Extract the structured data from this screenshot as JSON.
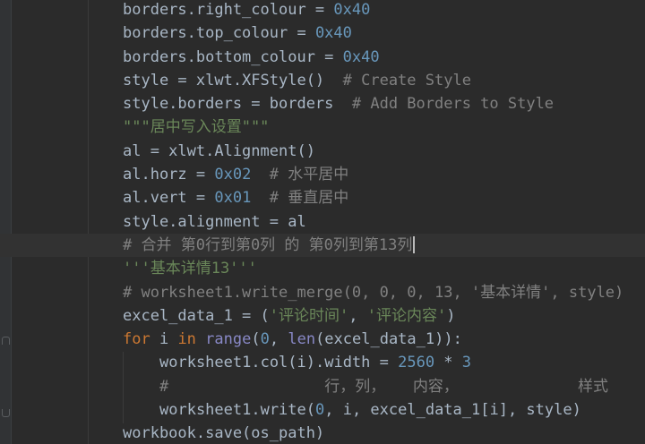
{
  "editor": {
    "lines": [
      {
        "id": "l1",
        "indent": 0,
        "tokens": [
          {
            "t": "borders.right_colour = ",
            "c": ""
          },
          {
            "t": "0x40",
            "c": "num"
          }
        ]
      },
      {
        "id": "l2",
        "indent": 0,
        "tokens": [
          {
            "t": "borders.top_colour = ",
            "c": ""
          },
          {
            "t": "0x40",
            "c": "num"
          }
        ]
      },
      {
        "id": "l3",
        "indent": 0,
        "tokens": [
          {
            "t": "borders.bottom_colour = ",
            "c": ""
          },
          {
            "t": "0x40",
            "c": "num"
          }
        ]
      },
      {
        "id": "l4",
        "indent": 0,
        "tokens": [
          {
            "t": "style = xlwt.XFStyle()  ",
            "c": ""
          },
          {
            "t": "# Create Style",
            "c": "cmt"
          }
        ]
      },
      {
        "id": "l5",
        "indent": 0,
        "tokens": [
          {
            "t": "style.borders = borders  ",
            "c": ""
          },
          {
            "t": "# Add Borders to Style",
            "c": "cmt"
          }
        ]
      },
      {
        "id": "l6",
        "indent": 0,
        "tokens": [
          {
            "t": "\"\"\"居中写入设置\"\"\"",
            "c": "str"
          }
        ]
      },
      {
        "id": "l7",
        "indent": 0,
        "tokens": [
          {
            "t": "al = xlwt.Alignment()",
            "c": ""
          }
        ]
      },
      {
        "id": "l8",
        "indent": 0,
        "tokens": [
          {
            "t": "al.horz = ",
            "c": ""
          },
          {
            "t": "0x02",
            "c": "num"
          },
          {
            "t": "  ",
            "c": ""
          },
          {
            "t": "# 水平居中",
            "c": "cmt"
          }
        ]
      },
      {
        "id": "l9",
        "indent": 0,
        "tokens": [
          {
            "t": "al.vert = ",
            "c": ""
          },
          {
            "t": "0x01",
            "c": "num"
          },
          {
            "t": "  ",
            "c": ""
          },
          {
            "t": "# 垂直居中",
            "c": "cmt"
          }
        ]
      },
      {
        "id": "l10",
        "indent": 0,
        "tokens": [
          {
            "t": "style.alignment = al",
            "c": ""
          }
        ]
      },
      {
        "id": "l11",
        "indent": 0,
        "current": true,
        "caret": true,
        "tokens": [
          {
            "t": "# 合并 第0行到第0列 的 第0列到第13列",
            "c": "cmt"
          }
        ]
      },
      {
        "id": "l12",
        "indent": 0,
        "tokens": [
          {
            "t": "'''基本详情13'''",
            "c": "str"
          }
        ]
      },
      {
        "id": "l13",
        "indent": 0,
        "tokens": [
          {
            "t": "# worksheet1.write_merge(0, 0, 0, 13, '基本详情', style)",
            "c": "cmt"
          }
        ]
      },
      {
        "id": "l14",
        "indent": 0,
        "tokens": [
          {
            "t": "excel_data_1 = (",
            "c": ""
          },
          {
            "t": "'评论时间'",
            "c": "str"
          },
          {
            "t": ", ",
            "c": ""
          },
          {
            "t": "'评论内容'",
            "c": "str"
          },
          {
            "t": ")",
            "c": ""
          }
        ]
      },
      {
        "id": "l15",
        "indent": 0,
        "tokens": [
          {
            "t": "for",
            "c": "kw"
          },
          {
            "t": " i ",
            "c": ""
          },
          {
            "t": "in",
            "c": "kw"
          },
          {
            "t": " ",
            "c": ""
          },
          {
            "t": "range",
            "c": "bi"
          },
          {
            "t": "(",
            "c": ""
          },
          {
            "t": "0",
            "c": "num"
          },
          {
            "t": ", ",
            "c": ""
          },
          {
            "t": "len",
            "c": "bi"
          },
          {
            "t": "(excel_data_1)):",
            "c": ""
          }
        ]
      },
      {
        "id": "l16",
        "indent": 1,
        "tokens": [
          {
            "t": "worksheet1.col(i).width = ",
            "c": ""
          },
          {
            "t": "2560",
            "c": "num"
          },
          {
            "t": " * ",
            "c": ""
          },
          {
            "t": "3",
            "c": "num"
          }
        ]
      },
      {
        "id": "l17",
        "indent": 1,
        "tokens": [
          {
            "t": "#                 行，列，   内容，             样式",
            "c": "cmt"
          }
        ]
      },
      {
        "id": "l18",
        "indent": 1,
        "tokens": [
          {
            "t": "worksheet1.write(",
            "c": ""
          },
          {
            "t": "0",
            "c": "num"
          },
          {
            "t": ", i, excel_data_1[i], style)",
            "c": ""
          }
        ]
      },
      {
        "id": "l19",
        "indent": 0,
        "tokens": [
          {
            "t": "workbook.save(os_path)",
            "c": ""
          }
        ]
      }
    ]
  }
}
